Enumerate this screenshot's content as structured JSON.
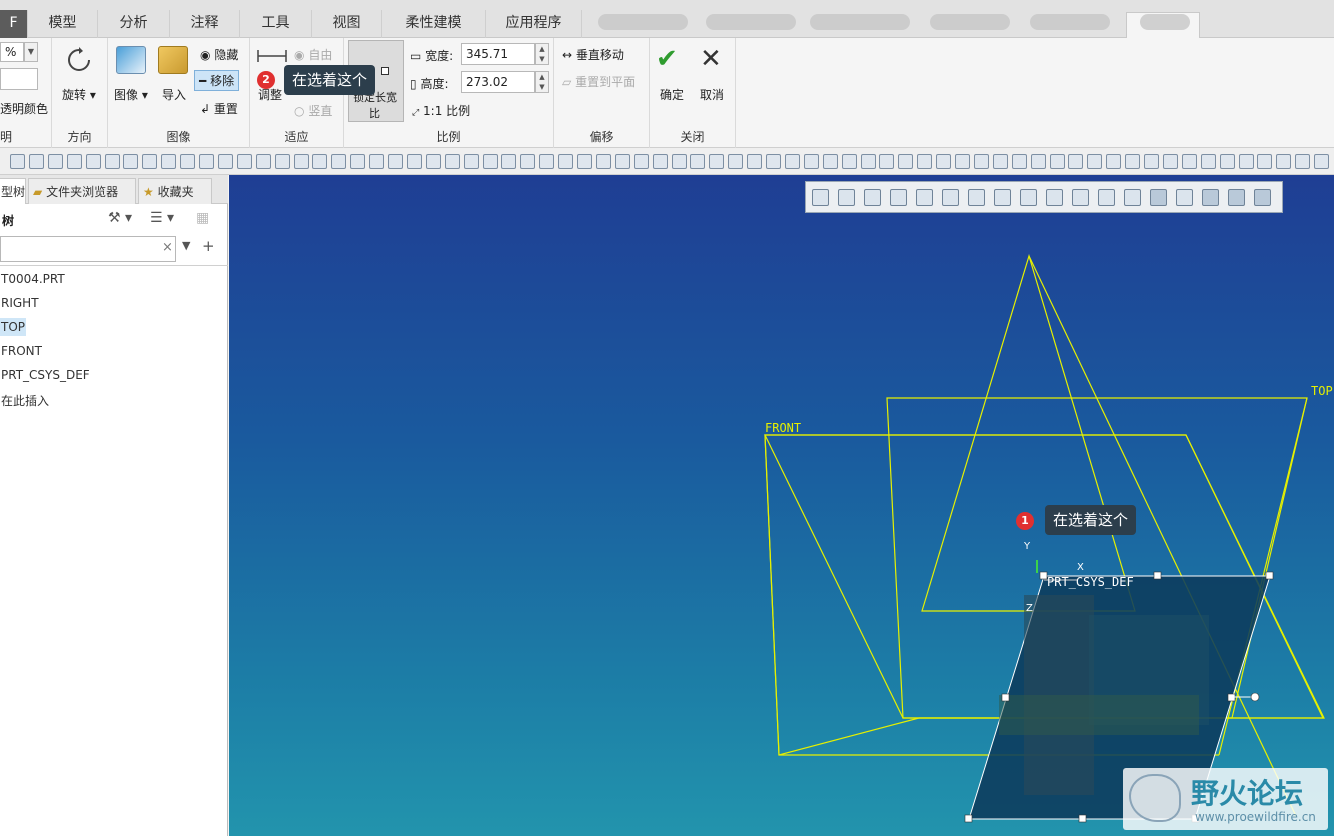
{
  "tabs": {
    "file": "F",
    "items": [
      "模型",
      "分析",
      "注释",
      "工具",
      "视图",
      "柔性建模",
      "应用程序"
    ]
  },
  "ribbon": {
    "left": {
      "percent": "%",
      "transparency": "透明颜色",
      "title": "明"
    },
    "direction": {
      "rotate": "旋转",
      "title": "方向"
    },
    "image": {
      "image_btn": "图像",
      "import": "导入",
      "hide": "隐藏",
      "move": "移除",
      "reset": "重置",
      "title": "图像"
    },
    "fit": {
      "adjust": "调整",
      "free": "自由",
      "vertical": "竖直",
      "title": "适应"
    },
    "scale": {
      "lock_ratio_top": "锁定长宽",
      "lock_ratio_bottom": "比",
      "width_label": "宽度:",
      "width_value": "345.71",
      "height_label": "高度:",
      "height_value": "273.02",
      "ratio": "1:1 比例",
      "title": "比例"
    },
    "offset": {
      "vertical_move": "垂直移动",
      "reset_plane": "重置到平面",
      "title": "偏移"
    },
    "close": {
      "ok": "确定",
      "cancel": "取消",
      "title": "关闭"
    }
  },
  "annotations": {
    "ribbon_badge": "2",
    "ribbon_tip": "在选着这个",
    "view_badge": "1",
    "view_tip": "在选着这个"
  },
  "sidebar": {
    "tabs": [
      "型树",
      "文件夹浏览器",
      "收藏夹"
    ],
    "header": "树",
    "items": [
      "T0004.PRT",
      "RIGHT",
      "TOP",
      "FRONT",
      "PRT_CSYS_DEF",
      "在此插入"
    ],
    "selected_index": 2
  },
  "viewport": {
    "labels": {
      "front": "FRONT",
      "top": "TOP",
      "csys": "PRT_CSYS_DEF",
      "x": "X",
      "y": "Y",
      "z": "Z"
    },
    "plane_color": "#e6f000"
  },
  "watermark": {
    "title": "野火论坛",
    "url": "www.proewildfire.cn"
  }
}
